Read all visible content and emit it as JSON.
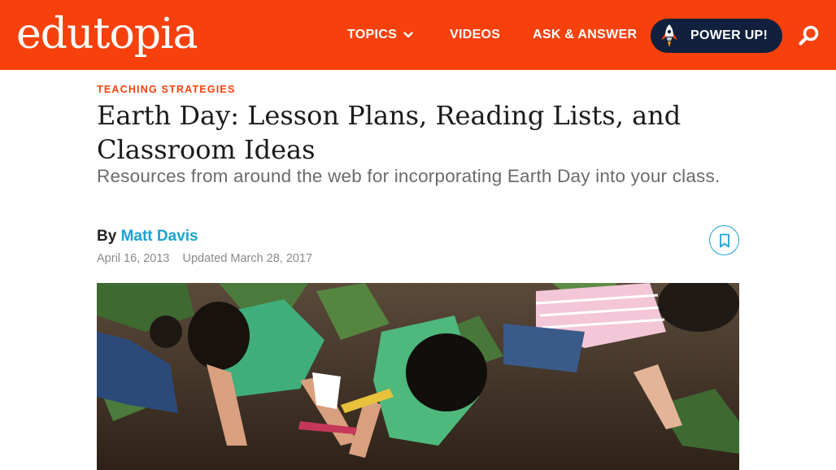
{
  "header": {
    "logo_text": "edutopia",
    "brand_color": "#f7410d",
    "nav": {
      "topics": "TOPICS",
      "videos": "VIDEOS",
      "ask_answer": "ASK & ANSWER"
    },
    "power_up": "POWER UP!",
    "power_up_bg": "#10203d"
  },
  "article": {
    "category": "TEACHING STRATEGIES",
    "title": "Earth Day: Lesson Plans, Reading Lists, and Classroom Ideas",
    "subtitle": "Resources from around the web for incorporating Earth Day into your class.",
    "by_label": "By",
    "author": "Matt Davis",
    "author_color": "#1aa3d5",
    "published": "April 16, 2013",
    "updated": "Updated March 28, 2017",
    "icons": {
      "bookmark": "bookmark-icon",
      "search": "search-icon",
      "rocket": "rocket-icon",
      "chevron": "chevron-down-icon"
    }
  }
}
